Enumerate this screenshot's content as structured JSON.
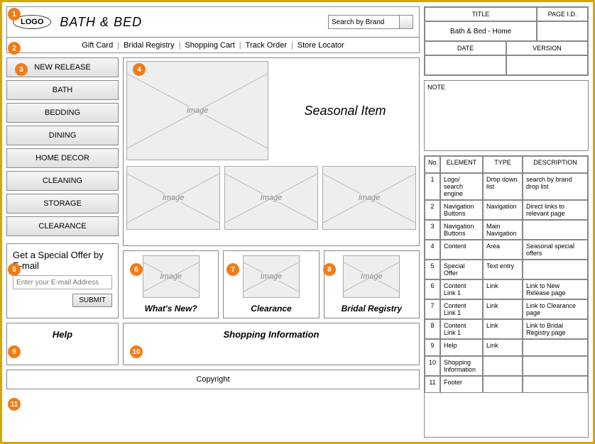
{
  "header": {
    "logo_text": "LOGO",
    "site_title": "BATH & BED",
    "search_placeholder": "Search by Brand"
  },
  "topnav": [
    "Gift Card",
    "Bridal Registry",
    "Shopping Cart",
    "Track Order",
    "Store Locator"
  ],
  "categories": [
    "NEW RELEASE",
    "BATH",
    "BEDDING",
    "DINING",
    "HOME DECOR",
    "CLEANING",
    "STORAGE",
    "CLEARANCE"
  ],
  "hero": {
    "image_label": "Image",
    "seasonal_label": "Seasonal Item"
  },
  "thumbs": [
    "Image",
    "Image",
    "Image"
  ],
  "offer": {
    "title": "Get a Special Offer by E-mail",
    "placeholder": "Enter your E-mail Address",
    "submit": "SUBMIT"
  },
  "cards": [
    {
      "img": "Image",
      "caption": "What's New?"
    },
    {
      "img": "Image",
      "caption": "Clearance"
    },
    {
      "img": "Image",
      "caption": "Bridal Registry"
    }
  ],
  "help_label": "Help",
  "shopinfo_label": "Shopping Information",
  "footer": "Copyright",
  "meta": {
    "title_head": "TITLE",
    "pageid_head": "PAGE I.D.",
    "title_value": "Bath & Bed - Home",
    "pageid_value": "",
    "date_head": "DATE",
    "version_head": "VERSION",
    "date_value": "",
    "version_value": "",
    "note_head": "NOTE"
  },
  "spec_headers": {
    "no": "No.",
    "element": "ELEMENT",
    "type": "TYPE",
    "description": "DESCRIPTION"
  },
  "spec_rows": [
    {
      "no": "1",
      "element": "Logo/ search engine",
      "type": "Drop down list",
      "description": "search by brand drop list"
    },
    {
      "no": "2",
      "element": "Navigation Buttons",
      "type": "Navigation",
      "description": "Direct links to relevant page"
    },
    {
      "no": "3",
      "element": "Navigation Buttons",
      "type": "Main Navigation",
      "description": ""
    },
    {
      "no": "4",
      "element": "Content",
      "type": "Area",
      "description": "Seasonal special offers"
    },
    {
      "no": "5",
      "element": "Special Offer",
      "type": "Text entry",
      "description": ""
    },
    {
      "no": "6",
      "element": "Content Link 1",
      "type": "Link",
      "description": "Link to New Release page"
    },
    {
      "no": "7",
      "element": "Content Link 1",
      "type": "Link",
      "description": "Link to Clearance page"
    },
    {
      "no": "8",
      "element": "Content Link 1",
      "type": "Link",
      "description": "Link to Bridal Registry page"
    },
    {
      "no": "9",
      "element": "Help",
      "type": "Link",
      "description": ""
    },
    {
      "no": "10",
      "element": "Shopping Information",
      "type": "",
      "description": ""
    },
    {
      "no": "11",
      "element": "Footer",
      "type": "",
      "description": ""
    }
  ],
  "annotations": [
    "1",
    "2",
    "3",
    "4",
    "5",
    "6",
    "7",
    "8",
    "9",
    "10",
    "11"
  ]
}
